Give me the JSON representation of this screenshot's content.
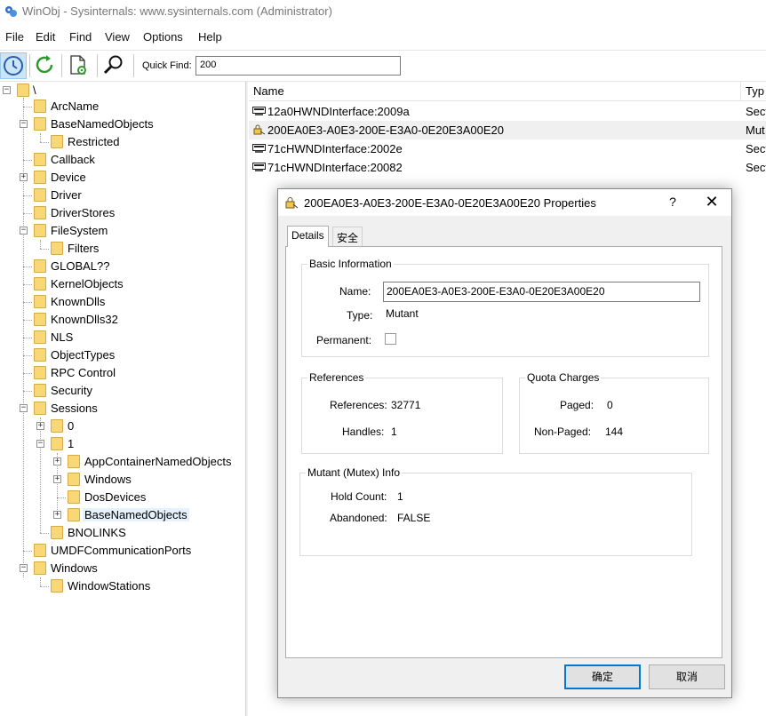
{
  "window": {
    "title": "WinObj - Sysinternals: www.sysinternals.com (Administrator)"
  },
  "menu": [
    "File",
    "Edit",
    "Find",
    "View",
    "Options",
    "Help"
  ],
  "toolbar": {
    "quick_find_label": "Quick Find:",
    "quick_find_value": "200"
  },
  "tree": {
    "root": "\\",
    "items": [
      "ArcName",
      "BaseNamedObjects",
      "Restricted",
      "Callback",
      "Device",
      "Driver",
      "DriverStores",
      "FileSystem",
      "Filters",
      "GLOBAL??",
      "KernelObjects",
      "KnownDlls",
      "KnownDlls32",
      "NLS",
      "ObjectTypes",
      "RPC Control",
      "Security",
      "Sessions",
      "0",
      "1",
      "AppContainerNamedObjects",
      "Windows",
      "DosDevices",
      "BaseNamedObjects",
      "BNOLINKS",
      "UMDFCommunicationPorts",
      "Windows",
      "WindowStations"
    ]
  },
  "list": {
    "columns": [
      "Name",
      "Typ"
    ],
    "rows": [
      {
        "name": "12a0HWNDInterface:2009a",
        "type": "Sect"
      },
      {
        "name": "200EA0E3-A0E3-200E-E3A0-0E20E3A00E20",
        "type": "Mut"
      },
      {
        "name": "71cHWNDInterface:2002e",
        "type": "Sect"
      },
      {
        "name": "71cHWNDInterface:20082",
        "type": "Sect"
      }
    ]
  },
  "dialog": {
    "title": "200EA0E3-A0E3-200E-E3A0-0E20E3A00E20 Properties",
    "help": "?",
    "close": "✕",
    "tabs": [
      "Details",
      "安全"
    ],
    "basic": {
      "title": "Basic Information",
      "name_label": "Name:",
      "name_value": "200EA0E3-A0E3-200E-E3A0-0E20E3A00E20",
      "type_label": "Type:",
      "type_value": "Mutant",
      "permanent_label": "Permanent:"
    },
    "references": {
      "title": "References",
      "references_label": "References:",
      "references_value": "32771",
      "handles_label": "Handles:",
      "handles_value": "1"
    },
    "quota": {
      "title": "Quota Charges",
      "paged_label": "Paged:",
      "paged_value": "0",
      "nonpaged_label": "Non-Paged:",
      "nonpaged_value": "144"
    },
    "mutant": {
      "title": "Mutant (Mutex) Info",
      "hold_label": "Hold Count:",
      "hold_value": "1",
      "abandoned_label": "Abandoned:",
      "abandoned_value": "FALSE"
    },
    "ok": "确定",
    "cancel": "取消"
  }
}
